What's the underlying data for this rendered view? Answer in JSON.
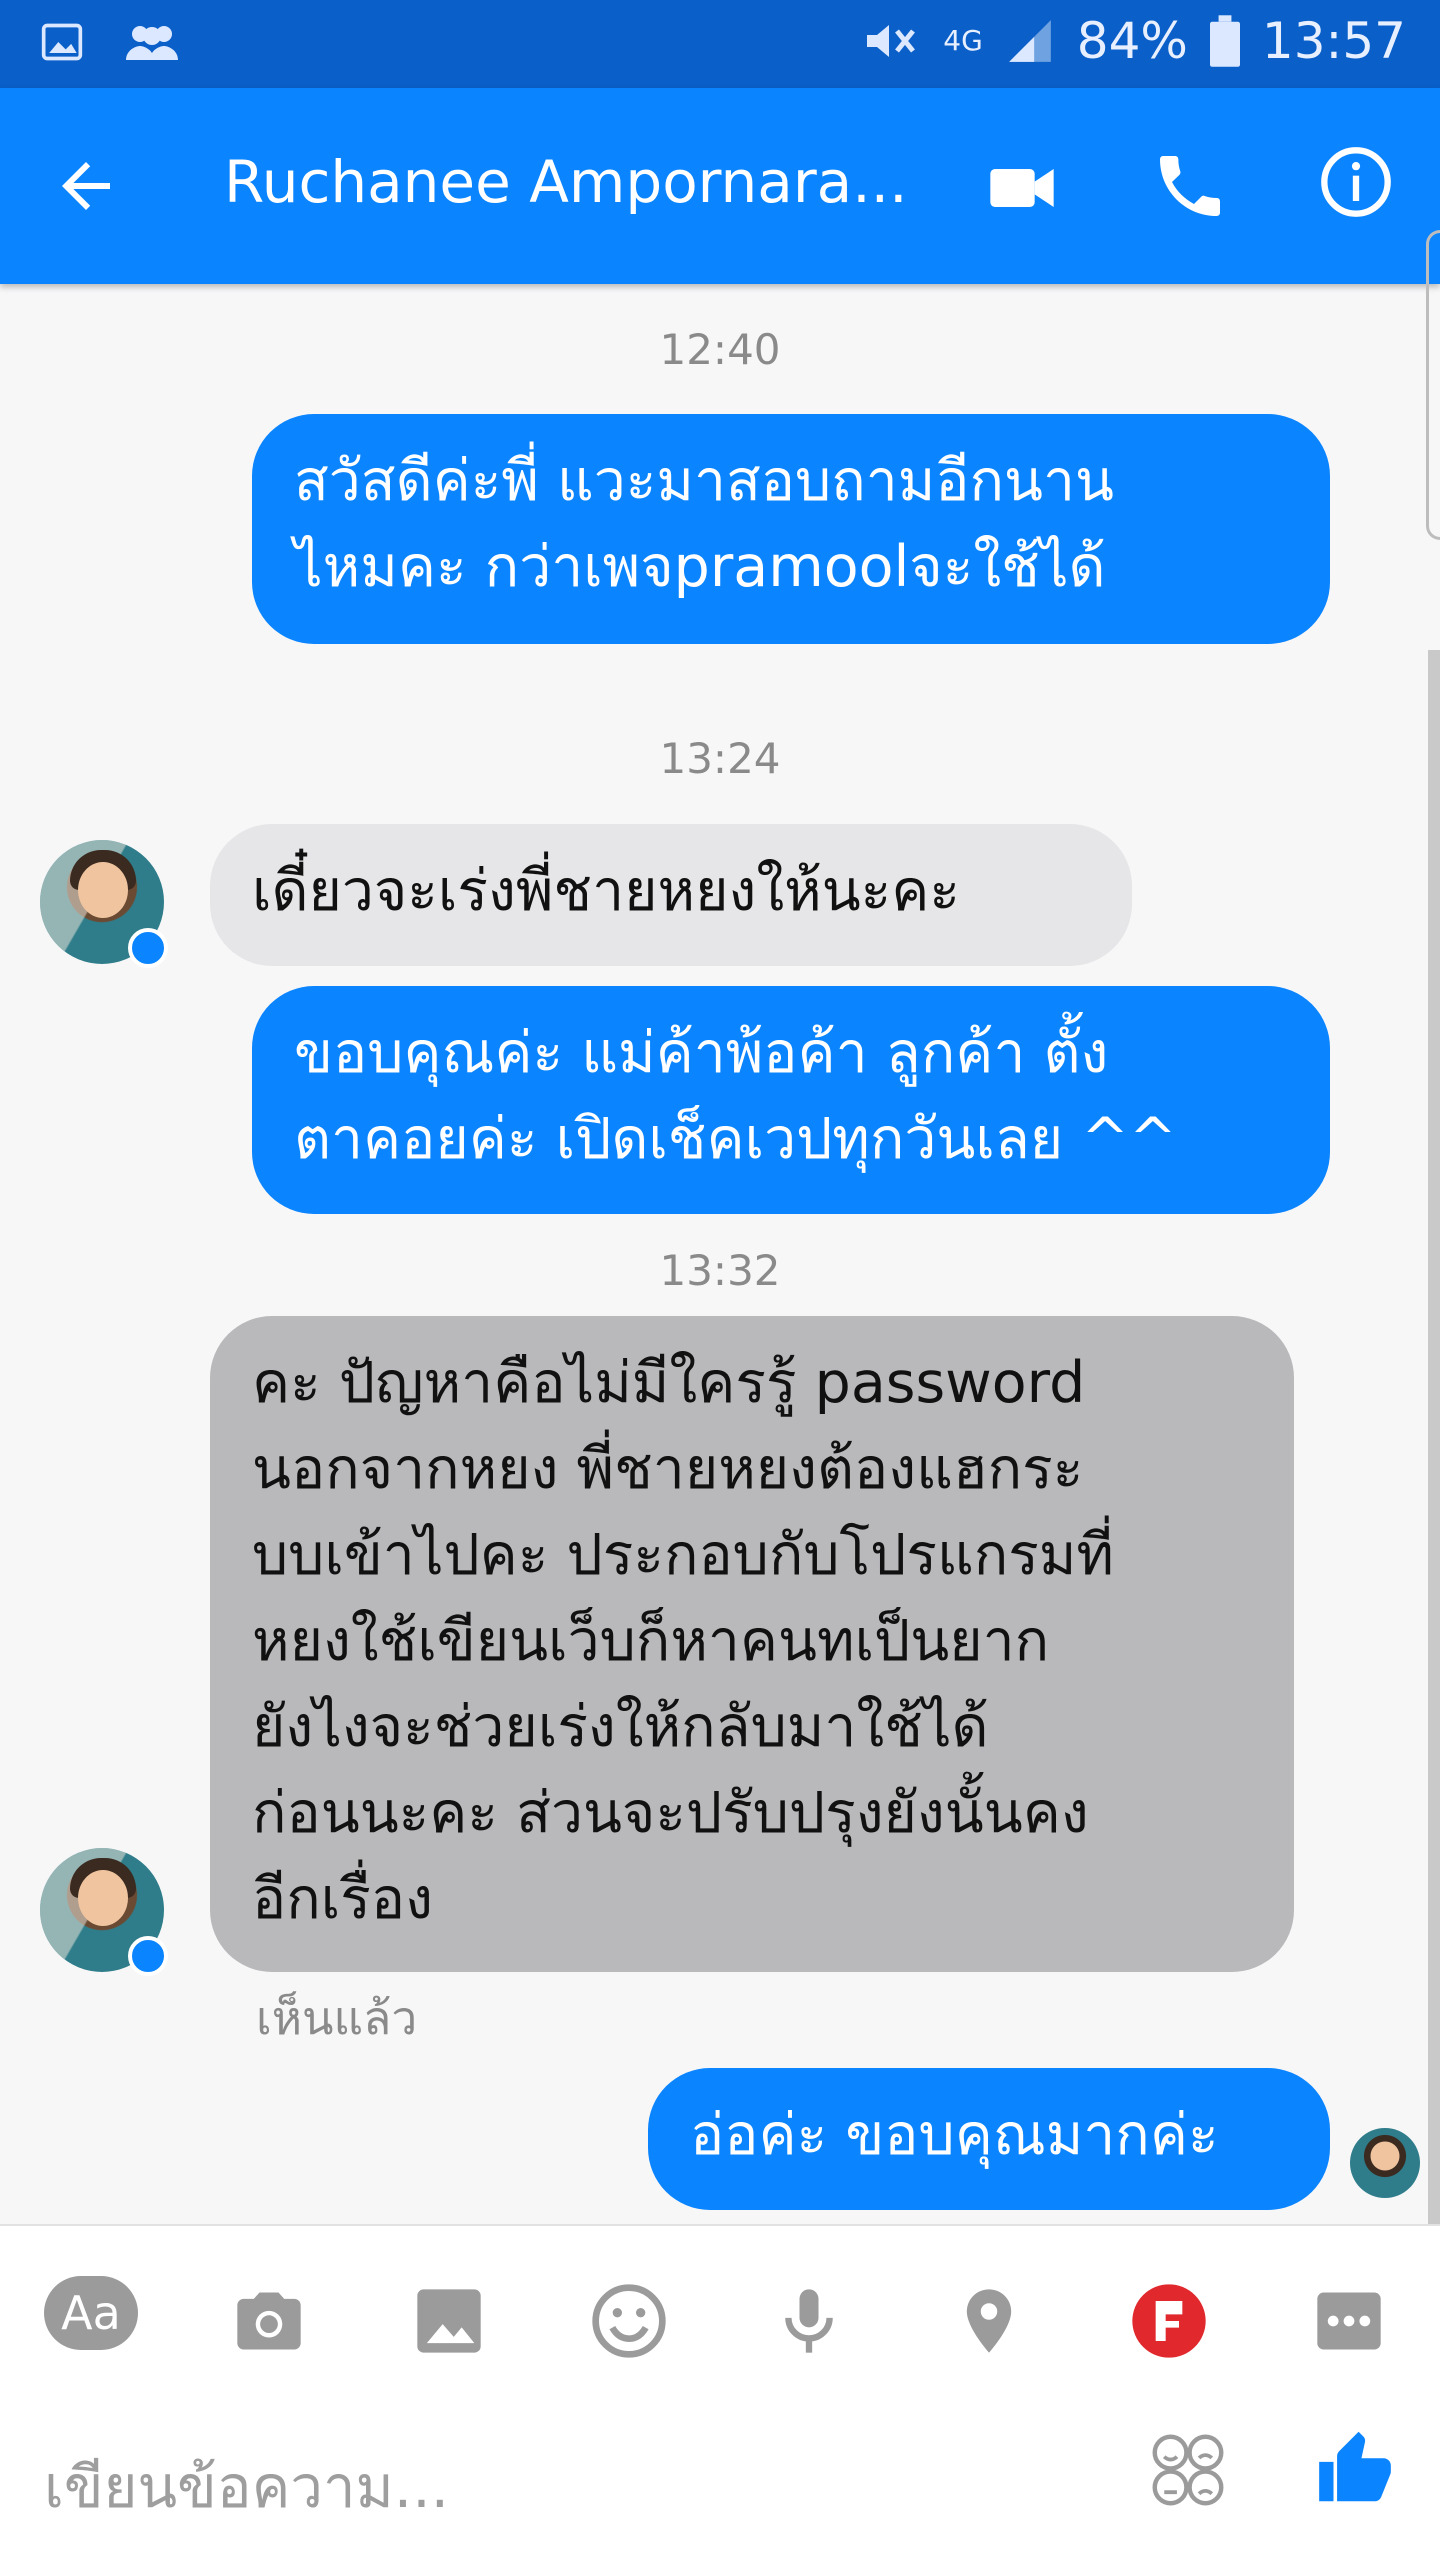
{
  "status_bar": {
    "battery": "84%",
    "time": "13:57",
    "network": "4G"
  },
  "app_bar": {
    "title": "Ruchanee Ampornara..."
  },
  "messages": {
    "ts1": "12:40",
    "m1": [
      "สวัสดีค่ะพี่ แวะมาสอบถามอีกนาน",
      "ไหมคะ กว่าเพจpramoolจะใช้ได้"
    ],
    "ts2": "13:24",
    "m2": "เดี๋ยวจะเร่งพี่ชายหยงให้นะคะ",
    "m3": [
      "ขอบคุณค่ะ แม่ค้าพ้อค้า ลูกค้า ตั้ง",
      "ตาคอยค่ะ เปิดเช็คเวปทุกวันเลย ^^"
    ],
    "ts3": "13:32",
    "m4": [
      "คะ ปัญหาคือไม่มีใครรู้ password",
      "นอกจากหยง พี่ชายหยงต้องแฮกระ",
      "บบเข้าไปคะ ประกอบกับโปรแกรมที่",
      "หยงใช้เขียนเว็บก็หาคนทเป็นยาก",
      "ยังไงจะช่วยเร่งให้กลับมาใช้ได้",
      "ก่อนนะคะ ส่วนจะปรับปรุงยังนั้นคง",
      "อีกเรื่อง"
    ],
    "seen": "เห็นแล้ว",
    "m5": "อ่อค่ะ ขอบคุณมากค่ะ"
  },
  "composer": {
    "aa_label": "Aa",
    "placeholder": "เขียนข้อความ..."
  },
  "colors": {
    "status_bar": "#0a5fc9",
    "app_bar": "#0a84ff",
    "outgoing_bubble": "#0a84ff",
    "incoming_bubble": "#e6e6e8",
    "incoming_bubble_highlight": "#b9b9bc",
    "flag_icon": "#e0282d"
  },
  "icons": [
    "image-icon",
    "contacts-icon",
    "mute-icon",
    "network-4g-icon",
    "signal-icon",
    "battery-icon",
    "back-arrow-icon",
    "video-call-icon",
    "phone-icon",
    "info-icon",
    "camera-icon",
    "gallery-icon",
    "smiley-icon",
    "microphone-icon",
    "location-icon",
    "flag-icon",
    "more-icon",
    "emoji-faces-icon",
    "thumbs-up-icon"
  ]
}
